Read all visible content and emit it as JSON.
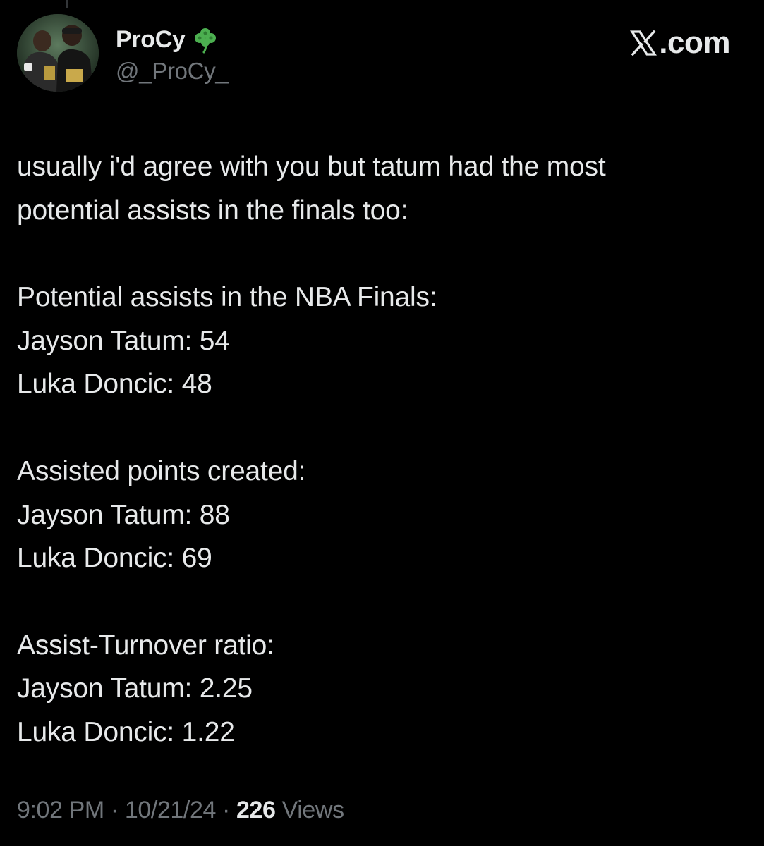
{
  "author": {
    "display_name": "ProCy",
    "handle": "@_ProCy_",
    "badge_icon": "shamrock-icon"
  },
  "brand": {
    "text": ".com",
    "logo_icon": "x-logo-icon"
  },
  "tweet": {
    "intro_lines": [
      "usually i'd agree with you but tatum had the most",
      "potential assists in the finals too:"
    ],
    "sections": [
      {
        "heading": "Potential assists in the NBA Finals:",
        "rows": [
          "Jayson Tatum: 54",
          "Luka Doncic: 48"
        ]
      },
      {
        "heading": "Assisted points created:",
        "rows": [
          "Jayson Tatum: 88",
          "Luka Doncic: 69"
        ]
      },
      {
        "heading": "Assist-Turnover ratio:",
        "rows": [
          "Jayson Tatum: 2.25",
          "Luka Doncic: 1.22"
        ]
      }
    ]
  },
  "meta": {
    "time": "9:02 PM",
    "separator": " · ",
    "date": "10/21/24",
    "views_count": "226",
    "views_label": " Views"
  },
  "colors": {
    "background": "#000000",
    "text_primary": "#e7e9ea",
    "text_secondary": "#71767b",
    "shamrock": "#4caf50"
  }
}
